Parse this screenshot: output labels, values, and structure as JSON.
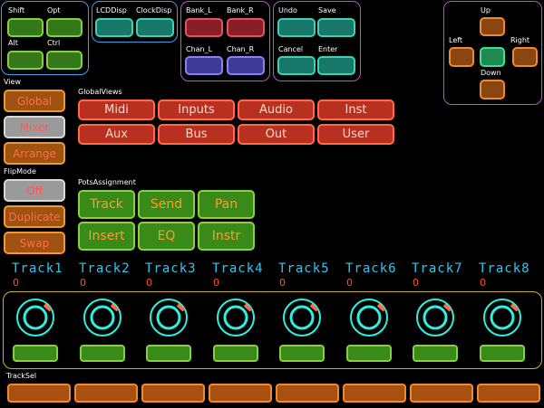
{
  "modifiers": {
    "shift": "Shift",
    "opt": "Opt",
    "alt": "Alt",
    "ctrl": "Ctrl"
  },
  "display": {
    "lcd": "LCDDisp",
    "clock": "ClockDisp"
  },
  "bank_chan": {
    "bank_l": "Bank_L",
    "bank_r": "Bank_R",
    "chan_l": "Chan_L",
    "chan_r": "Chan_R"
  },
  "edit": {
    "undo": "Undo",
    "save": "Save",
    "cancel": "Cancel",
    "enter": "Enter"
  },
  "nav": {
    "up": "Up",
    "left": "Left",
    "right": "Right",
    "down": "Down"
  },
  "view": {
    "label": "View",
    "items": [
      "Global",
      "Mixer",
      "Arrange"
    ],
    "selected": "Mixer"
  },
  "flipmode": {
    "label": "FlipMode",
    "items": [
      "Off",
      "Duplicate",
      "Swap"
    ],
    "selected": "Off"
  },
  "global_views": {
    "label": "GlobalViews",
    "items": [
      "Midi",
      "Inputs",
      "Audio",
      "Inst",
      "Aux",
      "Bus",
      "Out",
      "User"
    ]
  },
  "pots_assignment": {
    "label": "PotsAssignment",
    "items": [
      "Track",
      "Send",
      "Pan",
      "Insert",
      "EQ",
      "Instr"
    ]
  },
  "tracks": [
    {
      "name": "Track1",
      "value": "0"
    },
    {
      "name": "Track2",
      "value": "0"
    },
    {
      "name": "Track3",
      "value": "0"
    },
    {
      "name": "Track4",
      "value": "0"
    },
    {
      "name": "Track5",
      "value": "0"
    },
    {
      "name": "Track6",
      "value": "0"
    },
    {
      "name": "Track7",
      "value": "0"
    },
    {
      "name": "Track8",
      "value": "0"
    }
  ],
  "track_sel": {
    "label": "TrackSel"
  },
  "colors": {
    "knob_ring": "#2ef0e0",
    "knob_indicator": "#ff6a4a",
    "track_label": "#30c8f0",
    "track_value": "#ff5030"
  }
}
